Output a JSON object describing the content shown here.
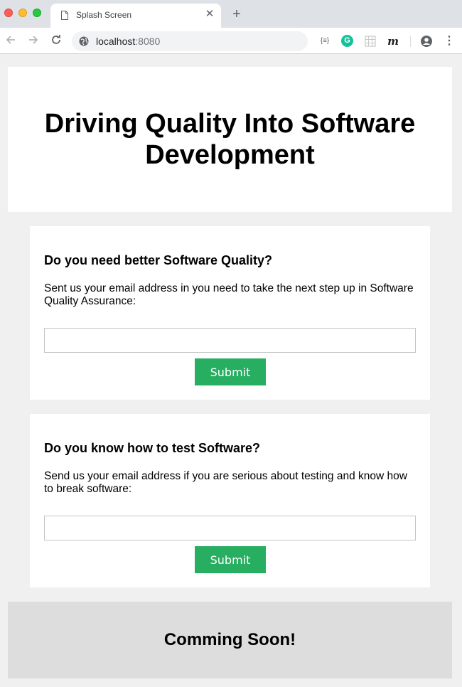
{
  "browser": {
    "tab_title": "Splash Screen",
    "tab_close": "✕",
    "new_tab": "+",
    "url_host": "localhost",
    "url_port": ":8080",
    "ext_json": "{≡}",
    "ext_grammarly": "G",
    "ext_m": "m",
    "menu": "⋮"
  },
  "hero": {
    "title": "Driving Quality Into Software Development"
  },
  "cards": [
    {
      "heading": "Do you need better Software Quality?",
      "text": "Sent us your email address in you need to take the next step up in Software Quality Assurance:",
      "input_value": "",
      "submit_label": "Submit"
    },
    {
      "heading": "Do you know how to test Software?",
      "text": "Send us your email address if you are serious about testing and know how to break software:",
      "input_value": "",
      "submit_label": "Submit"
    }
  ],
  "footer": {
    "text": "Comming Soon!"
  },
  "colors": {
    "accent": "#27ae60",
    "page_bg": "#f0f0f0",
    "footer_bg": "#dddddd"
  },
  "icons": [
    "document-icon",
    "back-arrow-icon",
    "forward-arrow-icon",
    "reload-icon",
    "globe-icon",
    "json-viewer-icon",
    "grammarly-icon",
    "grid-extension-icon",
    "m-extension-icon",
    "account-icon",
    "menu-icon"
  ]
}
